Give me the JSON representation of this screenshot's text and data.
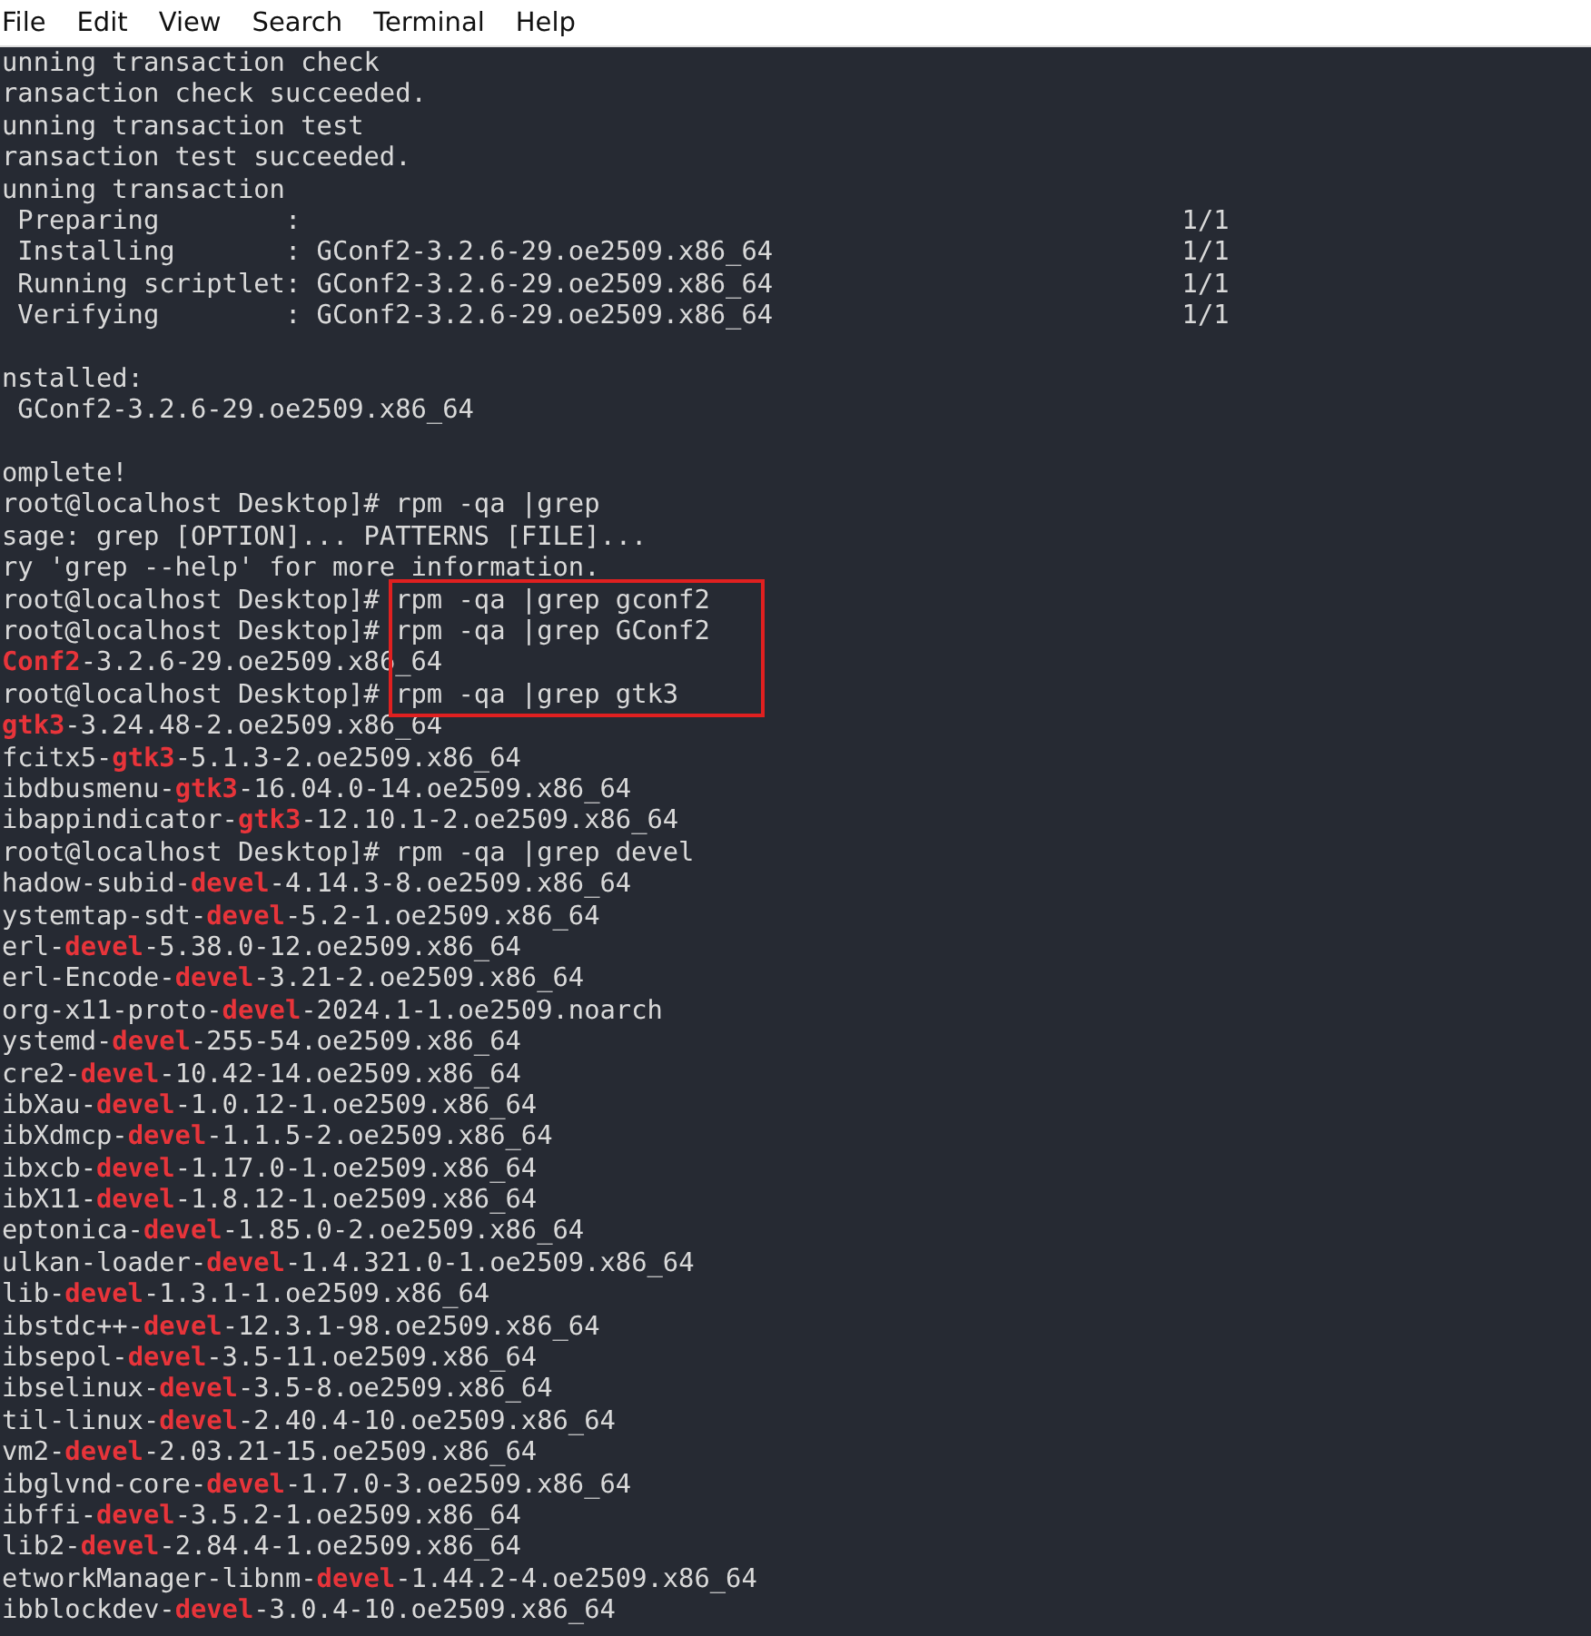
{
  "menu": [
    "File",
    "Edit",
    "View",
    "Search",
    "Terminal",
    "Help"
  ],
  "lines": [
    {
      "kind": "text",
      "segments": [
        {
          "text": "unning transaction check",
          "match": false
        }
      ]
    },
    {
      "kind": "text",
      "segments": [
        {
          "text": "ransaction check succeeded.",
          "match": false
        }
      ]
    },
    {
      "kind": "text",
      "segments": [
        {
          "text": "unning transaction test",
          "match": false
        }
      ]
    },
    {
      "kind": "text",
      "segments": [
        {
          "text": "ransaction test succeeded.",
          "match": false
        }
      ]
    },
    {
      "kind": "text",
      "segments": [
        {
          "text": "unning transaction",
          "match": false
        }
      ]
    },
    {
      "kind": "progress",
      "segments": [
        {
          "text": " Preparing        :",
          "match": false
        }
      ],
      "count": "1/1"
    },
    {
      "kind": "progress",
      "segments": [
        {
          "text": " Installing       : GConf2-3.2.6-29.oe2509.x86_64",
          "match": false
        }
      ],
      "count": "1/1"
    },
    {
      "kind": "progress",
      "segments": [
        {
          "text": " Running scriptlet: GConf2-3.2.6-29.oe2509.x86_64",
          "match": false
        }
      ],
      "count": "1/1"
    },
    {
      "kind": "progress",
      "segments": [
        {
          "text": " Verifying        : GConf2-3.2.6-29.oe2509.x86_64",
          "match": false
        }
      ],
      "count": "1/1"
    },
    {
      "kind": "blank"
    },
    {
      "kind": "text",
      "segments": [
        {
          "text": "nstalled:",
          "match": false
        }
      ]
    },
    {
      "kind": "text",
      "segments": [
        {
          "text": " GConf2-3.2.6-29.oe2509.x86_64",
          "match": false
        }
      ]
    },
    {
      "kind": "blank"
    },
    {
      "kind": "text",
      "segments": [
        {
          "text": "omplete!",
          "match": false
        }
      ]
    },
    {
      "kind": "text",
      "segments": [
        {
          "text": "root@localhost Desktop]# rpm -qa |grep",
          "match": false
        }
      ]
    },
    {
      "kind": "text",
      "segments": [
        {
          "text": "sage: grep [OPTION]... PATTERNS [FILE]...",
          "match": false
        }
      ]
    },
    {
      "kind": "text",
      "segments": [
        {
          "text": "ry 'grep --help' for more information.",
          "match": false
        }
      ]
    },
    {
      "kind": "text",
      "segments": [
        {
          "text": "root@localhost Desktop]# ",
          "match": false
        },
        {
          "text": "rpm -qa |grep gconf2",
          "match": false,
          "boxed": true
        }
      ]
    },
    {
      "kind": "text",
      "segments": [
        {
          "text": "root@localhost Desktop]# ",
          "match": false
        },
        {
          "text": "rpm -qa |grep GConf2",
          "match": false,
          "boxed": true
        }
      ]
    },
    {
      "kind": "text",
      "segments": [
        {
          "text": "Conf2",
          "match": true
        },
        {
          "text": "-3.2.6-29.oe2509.x86_64",
          "match": false
        }
      ]
    },
    {
      "kind": "text",
      "segments": [
        {
          "text": "root@localhost Desktop]# ",
          "match": false
        },
        {
          "text": "rpm -qa |grep gtk3",
          "match": false,
          "boxed": true
        }
      ]
    },
    {
      "kind": "text",
      "segments": [
        {
          "text": "gtk3",
          "match": true
        },
        {
          "text": "-3.24.48-2.oe2509.x86_64",
          "match": false
        }
      ]
    },
    {
      "kind": "text",
      "segments": [
        {
          "text": "fcitx5-",
          "match": false
        },
        {
          "text": "gtk3",
          "match": true
        },
        {
          "text": "-5.1.3-2.oe2509.x86_64",
          "match": false
        }
      ]
    },
    {
      "kind": "text",
      "segments": [
        {
          "text": "ibdbusmenu-",
          "match": false
        },
        {
          "text": "gtk3",
          "match": true
        },
        {
          "text": "-16.04.0-14.oe2509.x86_64",
          "match": false
        }
      ]
    },
    {
      "kind": "text",
      "segments": [
        {
          "text": "ibappindicator-",
          "match": false
        },
        {
          "text": "gtk3",
          "match": true
        },
        {
          "text": "-12.10.1-2.oe2509.x86_64",
          "match": false
        }
      ]
    },
    {
      "kind": "text",
      "segments": [
        {
          "text": "root@localhost Desktop]# rpm -qa |grep devel",
          "match": false
        }
      ]
    },
    {
      "kind": "text",
      "segments": [
        {
          "text": "hadow-subid-",
          "match": false
        },
        {
          "text": "devel",
          "match": true
        },
        {
          "text": "-4.14.3-8.oe2509.x86_64",
          "match": false
        }
      ]
    },
    {
      "kind": "text",
      "segments": [
        {
          "text": "ystemtap-sdt-",
          "match": false
        },
        {
          "text": "devel",
          "match": true
        },
        {
          "text": "-5.2-1.oe2509.x86_64",
          "match": false
        }
      ]
    },
    {
      "kind": "text",
      "segments": [
        {
          "text": "erl-",
          "match": false
        },
        {
          "text": "devel",
          "match": true
        },
        {
          "text": "-5.38.0-12.oe2509.x86_64",
          "match": false
        }
      ]
    },
    {
      "kind": "text",
      "segments": [
        {
          "text": "erl-Encode-",
          "match": false
        },
        {
          "text": "devel",
          "match": true
        },
        {
          "text": "-3.21-2.oe2509.x86_64",
          "match": false
        }
      ]
    },
    {
      "kind": "text",
      "segments": [
        {
          "text": "org-x11-proto-",
          "match": false
        },
        {
          "text": "devel",
          "match": true
        },
        {
          "text": "-2024.1-1.oe2509.noarch",
          "match": false
        }
      ]
    },
    {
      "kind": "text",
      "segments": [
        {
          "text": "ystemd-",
          "match": false
        },
        {
          "text": "devel",
          "match": true
        },
        {
          "text": "-255-54.oe2509.x86_64",
          "match": false
        }
      ]
    },
    {
      "kind": "text",
      "segments": [
        {
          "text": "cre2-",
          "match": false
        },
        {
          "text": "devel",
          "match": true
        },
        {
          "text": "-10.42-14.oe2509.x86_64",
          "match": false
        }
      ]
    },
    {
      "kind": "text",
      "segments": [
        {
          "text": "ibXau-",
          "match": false
        },
        {
          "text": "devel",
          "match": true
        },
        {
          "text": "-1.0.12-1.oe2509.x86_64",
          "match": false
        }
      ]
    },
    {
      "kind": "text",
      "segments": [
        {
          "text": "ibXdmcp-",
          "match": false
        },
        {
          "text": "devel",
          "match": true
        },
        {
          "text": "-1.1.5-2.oe2509.x86_64",
          "match": false
        }
      ]
    },
    {
      "kind": "text",
      "segments": [
        {
          "text": "ibxcb-",
          "match": false
        },
        {
          "text": "devel",
          "match": true
        },
        {
          "text": "-1.17.0-1.oe2509.x86_64",
          "match": false
        }
      ]
    },
    {
      "kind": "text",
      "segments": [
        {
          "text": "ibX11-",
          "match": false
        },
        {
          "text": "devel",
          "match": true
        },
        {
          "text": "-1.8.12-1.oe2509.x86_64",
          "match": false
        }
      ]
    },
    {
      "kind": "text",
      "segments": [
        {
          "text": "eptonica-",
          "match": false
        },
        {
          "text": "devel",
          "match": true
        },
        {
          "text": "-1.85.0-2.oe2509.x86_64",
          "match": false
        }
      ]
    },
    {
      "kind": "text",
      "segments": [
        {
          "text": "ulkan-loader-",
          "match": false
        },
        {
          "text": "devel",
          "match": true
        },
        {
          "text": "-1.4.321.0-1.oe2509.x86_64",
          "match": false
        }
      ]
    },
    {
      "kind": "text",
      "segments": [
        {
          "text": "lib-",
          "match": false
        },
        {
          "text": "devel",
          "match": true
        },
        {
          "text": "-1.3.1-1.oe2509.x86_64",
          "match": false
        }
      ]
    },
    {
      "kind": "text",
      "segments": [
        {
          "text": "ibstdc++-",
          "match": false
        },
        {
          "text": "devel",
          "match": true
        },
        {
          "text": "-12.3.1-98.oe2509.x86_64",
          "match": false
        }
      ]
    },
    {
      "kind": "text",
      "segments": [
        {
          "text": "ibsepol-",
          "match": false
        },
        {
          "text": "devel",
          "match": true
        },
        {
          "text": "-3.5-11.oe2509.x86_64",
          "match": false
        }
      ]
    },
    {
      "kind": "text",
      "segments": [
        {
          "text": "ibselinux-",
          "match": false
        },
        {
          "text": "devel",
          "match": true
        },
        {
          "text": "-3.5-8.oe2509.x86_64",
          "match": false
        }
      ]
    },
    {
      "kind": "text",
      "segments": [
        {
          "text": "til-linux-",
          "match": false
        },
        {
          "text": "devel",
          "match": true
        },
        {
          "text": "-2.40.4-10.oe2509.x86_64",
          "match": false
        }
      ]
    },
    {
      "kind": "text",
      "segments": [
        {
          "text": "vm2-",
          "match": false
        },
        {
          "text": "devel",
          "match": true
        },
        {
          "text": "-2.03.21-15.oe2509.x86_64",
          "match": false
        }
      ]
    },
    {
      "kind": "text",
      "segments": [
        {
          "text": "ibglvnd-core-",
          "match": false
        },
        {
          "text": "devel",
          "match": true
        },
        {
          "text": "-1.7.0-3.oe2509.x86_64",
          "match": false
        }
      ]
    },
    {
      "kind": "text",
      "segments": [
        {
          "text": "ibffi-",
          "match": false
        },
        {
          "text": "devel",
          "match": true
        },
        {
          "text": "-3.5.2-1.oe2509.x86_64",
          "match": false
        }
      ]
    },
    {
      "kind": "text",
      "segments": [
        {
          "text": "lib2-",
          "match": false
        },
        {
          "text": "devel",
          "match": true
        },
        {
          "text": "-2.84.4-1.oe2509.x86_64",
          "match": false
        }
      ]
    },
    {
      "kind": "text",
      "segments": [
        {
          "text": "etworkManager-libnm-",
          "match": false
        },
        {
          "text": "devel",
          "match": true
        },
        {
          "text": "-1.44.2-4.oe2509.x86_64",
          "match": false
        }
      ]
    },
    {
      "kind": "text",
      "segments": [
        {
          "text": "ibblockdev-",
          "match": false
        },
        {
          "text": "devel",
          "match": true
        },
        {
          "text": "-3.0.4-10.oe2509.x86_64",
          "match": false
        }
      ]
    }
  ]
}
